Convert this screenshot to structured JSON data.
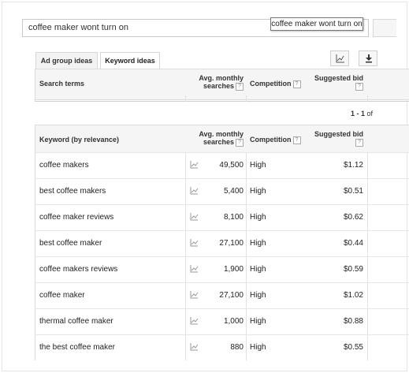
{
  "search": {
    "value": "coffee maker wont turn on",
    "tooltip": "coffee maker wont turn on"
  },
  "tabs": [
    {
      "label": "Ad group ideas",
      "active": false
    },
    {
      "label": "Keyword ideas",
      "active": true
    }
  ],
  "toolbar": {
    "chart_icon": "line-chart-icon",
    "download_icon": "download-icon"
  },
  "search_terms_table": {
    "headers": {
      "term": "Search terms",
      "avg_line1": "Avg. monthly",
      "avg_line2": "searches",
      "competition": "Competition",
      "bid_line1": "Suggested bid"
    },
    "help_glyph": "?"
  },
  "pager": {
    "range": "1 - 1",
    "suffix": "of"
  },
  "keyword_table": {
    "headers": {
      "keyword": "Keyword (by relevance)",
      "avg_line1": "Avg. monthly",
      "avg_line2": "searches",
      "competition": "Competition",
      "bid_line1": "Suggested bid"
    },
    "help_glyph": "?",
    "rows": [
      {
        "keyword": "coffee makers",
        "searches": "49,500",
        "competition": "High",
        "bid": "$1.12"
      },
      {
        "keyword": "best coffee makers",
        "searches": "5,400",
        "competition": "High",
        "bid": "$0.51"
      },
      {
        "keyword": "coffee maker reviews",
        "searches": "8,100",
        "competition": "High",
        "bid": "$0.62"
      },
      {
        "keyword": "best coffee maker",
        "searches": "27,100",
        "competition": "High",
        "bid": "$0.44"
      },
      {
        "keyword": "coffee makers reviews",
        "searches": "1,900",
        "competition": "High",
        "bid": "$0.59"
      },
      {
        "keyword": "coffee maker",
        "searches": "27,100",
        "competition": "High",
        "bid": "$1.02"
      },
      {
        "keyword": "thermal coffee maker",
        "searches": "1,000",
        "competition": "High",
        "bid": "$0.88"
      },
      {
        "keyword": "the best coffee maker",
        "searches": "880",
        "competition": "High",
        "bid": "$0.55"
      }
    ]
  }
}
